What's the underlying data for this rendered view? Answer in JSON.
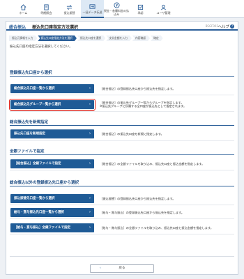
{
  "nav": [
    {
      "label": "ホーム",
      "icon": "home-icon"
    },
    {
      "label": "明細照会",
      "icon": "document-icon"
    },
    {
      "label": "振込振替",
      "icon": "transfer-icon"
    },
    {
      "label": "一括データ伝送",
      "icon": "data-transfer-icon"
    },
    {
      "label": "税金・各種料金の払込み",
      "icon": "yen-payment-icon"
    },
    {
      "label": "承認",
      "icon": "approval-icon"
    },
    {
      "label": "ユーザ管理",
      "icon": "user-icon"
    }
  ],
  "header": {
    "category": "総合振込",
    "title": "振込先口座指定方法選択",
    "code": "BSGF003",
    "help": "ヘルプ"
  },
  "steps": [
    "振込元情報を入力",
    "振込先口座指定方法を選択",
    "振込先口座を選択",
    "支払金額を入力",
    "内容確認",
    "確定"
  ],
  "instruction": "振込先口座の指定方法を選択してください。",
  "sections": {
    "registered": {
      "title": "登録振込先口座から選択",
      "rows": [
        {
          "button": "総合振込先口座一覧から選択",
          "desc": [
            "［総合振込］の登録振込先口座から振込先を指定します。"
          ]
        },
        {
          "button": "総合振込先グループ一覧から選択",
          "desc": [
            "［総合振込］の振込先グループ一覧からグループを指定します。",
            "※振込先グループに所属する全口座が振込先として指定されます。"
          ]
        }
      ]
    },
    "new": {
      "title": "総合振込先を新規指定",
      "rows": [
        {
          "button": "振込先口座を新規指定",
          "desc": [
            "［総合振込］の振込先口座を新規に指定します。"
          ]
        }
      ]
    },
    "file": {
      "title": "全銀ファイルで指定",
      "rows": [
        {
          "button": "［総合振込］全銀ファイルで指定",
          "desc": [
            "［総合振込］の全銀ファイルを取り込み、振込先口座と振込金額を指定します。"
          ]
        }
      ]
    },
    "other": {
      "title": "総合振込以外の登録振込先口座から選択",
      "rows": [
        {
          "button": "振込振替先口座一覧から選択",
          "desc": [
            "［振込振替］の登録振込先口座から振込先を指定します。"
          ]
        },
        {
          "button": "給与・賞与振込先口座一覧から選択",
          "desc": [
            "［給与・賞与振込］の登録振込先口座から振込先を指定します。"
          ]
        },
        {
          "button": "［給与・賞与振込］全銀ファイルで指定",
          "desc": [
            "［給与・賞与振込］の全銀ファイルを取り込み、振込先口座と振込金額を指定します。"
          ]
        }
      ]
    }
  },
  "back_label": "戻る"
}
